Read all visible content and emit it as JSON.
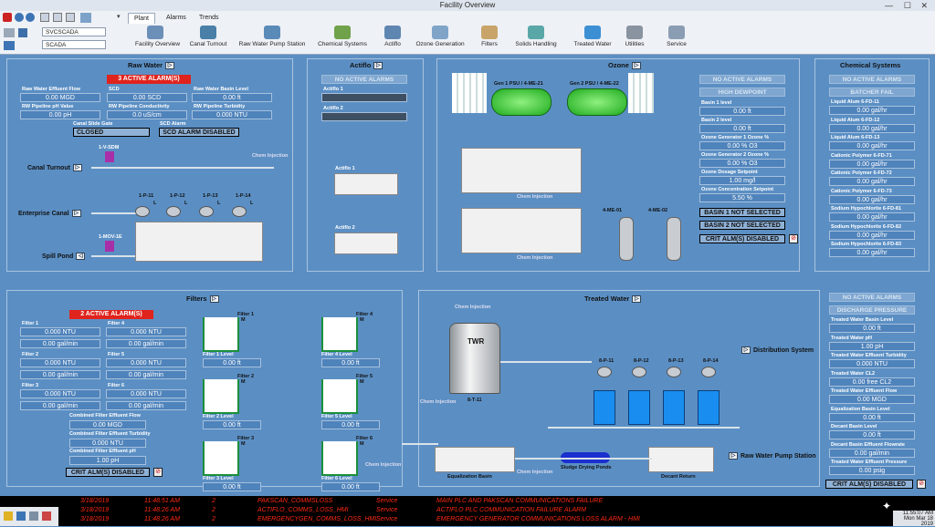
{
  "window": {
    "title": "Facility Overview",
    "minimize": "—",
    "maximize": "☐",
    "close": "✕"
  },
  "toolbar": {
    "tabs": [
      "Plant",
      "Alarms",
      "Trends"
    ],
    "server1": "SVCSCADA",
    "server2": "SCADA",
    "nav": [
      {
        "label": "Facility Overview",
        "icon": "home-icon",
        "color": "#6c8fb8"
      },
      {
        "label": "Canal Turnout",
        "icon": "canal-icon",
        "color": "#4a7fa8"
      },
      {
        "label": "Raw Water Pump Station",
        "icon": "pump-station-icon",
        "color": "#5a8ab8"
      },
      {
        "label": "Chemical Systems",
        "icon": "chemical-icon",
        "color": "#6fa24a"
      },
      {
        "label": "Actiflo",
        "icon": "actiflo-icon",
        "color": "#5f86b0"
      },
      {
        "label": "Ozone Generation",
        "icon": "ozone-icon",
        "color": "#7fa4c8"
      },
      {
        "label": "Filters",
        "icon": "filters-icon",
        "color": "#c9a46a"
      },
      {
        "label": "Solids Handling",
        "icon": "solids-icon",
        "color": "#5aa7a8"
      },
      {
        "label": "Treated Water",
        "icon": "water-drop-icon",
        "color": "#3c8fd2"
      },
      {
        "label": "Utilities",
        "icon": "wrench-icon",
        "color": "#8a93a0"
      },
      {
        "label": "Service",
        "icon": "service-icon",
        "color": "#8b9db3"
      }
    ]
  },
  "raw_water": {
    "title": "Raw Water",
    "alarm": "3 ACTIVE ALARM(S)",
    "fields": [
      {
        "label": "Raw Water Effluent Flow",
        "value": "0.00 MGD"
      },
      {
        "label": "SCD",
        "value": "0.00 SCD"
      },
      {
        "label": "Raw Water Basin Level",
        "value": "0.00 ft"
      },
      {
        "label": "RW Pipeline pH Value",
        "value": "0.00 pH"
      },
      {
        "label": "RW Pipeline Conductivity",
        "value": "0.0 uS/cm"
      },
      {
        "label": "RW Pipeline Turbidity",
        "value": "0.000 NTU"
      }
    ],
    "gate_label": "Canal Slide Gate",
    "gate_value": "CLOSED",
    "scd_alarm_label": "SCD Alarm",
    "scd_alarm_value": "SCD ALARM DISABLED",
    "canal_turnout": "Canal Turnout",
    "enterprise_canal": "Enterprise Canal",
    "spill_pond": "Spill Pond",
    "chem_injection": "Chem Injection",
    "pumps": [
      "1-P-11",
      "1-P-12",
      "1-P-13",
      "1-P-14"
    ],
    "valve1": "1-V-SDM",
    "valve2": "1-MOV-1E",
    "pump_l": "L"
  },
  "actiflo": {
    "title": "Actiflo",
    "no_alarms": "NO ACTIVE ALARMS",
    "f1_label": "Actiflo 1",
    "f2_label": "Actiflo 2",
    "unit1": "Actiflo 1",
    "unit2": "Actiflo 2"
  },
  "ozone": {
    "title": "Ozone",
    "gen1": "Gen 1 PSU / 4-ME-21",
    "gen2": "Gen 2 PSU / 4-ME-22",
    "chem1": "Chem Injection",
    "chem2": "Chem Injection",
    "tank1": "4-ME-01",
    "tank2": "4-ME-02",
    "no_alarms": "NO ACTIVE ALARMS",
    "dewpoint": "HIGH DEWPOINT",
    "fields": [
      {
        "label": "Basin 1 level",
        "value": "0.00 ft"
      },
      {
        "label": "Basin 2 level",
        "value": "0.00 ft"
      },
      {
        "label": "Ozone Generator 1 Ozone %",
        "value": "0.00 % O3"
      },
      {
        "label": "Ozone Generator 2 Ozone %",
        "value": "0.00 % O3"
      },
      {
        "label": "Ozone Dosage Setpoint",
        "value": "1.00 mg/l"
      },
      {
        "label": "Ozone Concentration Setpoint",
        "value": "5.50 %"
      }
    ],
    "basin1": "BASIN 1 NOT SELECTED",
    "basin2": "BASIN 2 NOT SELECTED",
    "crit": "CRIT ALM(S) DISABLED"
  },
  "chemical": {
    "title": "Chemical Systems",
    "no_alarms": "NO ACTIVE ALARMS",
    "batcher": "BATCHER FAIL",
    "fields": [
      {
        "label": "Liquid Alum 6-FD-11",
        "value": "0.00 gal/hr"
      },
      {
        "label": "Liquid Alum 6-FD-12",
        "value": "0.00 gal/hr"
      },
      {
        "label": "Liquid Alum 6-FD-13",
        "value": "0.00 gal/hr"
      },
      {
        "label": "Cationic Polymer 6-FD-71",
        "value": "0.00 gal/hr"
      },
      {
        "label": "Cationic Polymer 6-FD-72",
        "value": "0.00 gal/hr"
      },
      {
        "label": "Cationic Polymer 6-FD-73",
        "value": "0.00 gal/hr"
      },
      {
        "label": "Sodium Hypochlorite 6-FD-81",
        "value": "0.00 gal/hr"
      },
      {
        "label": "Sodium Hypochlorite 6-FD-82",
        "value": "0.00 gal/hr"
      },
      {
        "label": "Sodium Hypochlorite 6-FD-83",
        "value": "0.00 gal/hr"
      }
    ]
  },
  "filters": {
    "title": "Filters",
    "alarm": "2 ACTIVE ALARM(S)",
    "fields": [
      {
        "label": "Filter 1",
        "v1": "0.000 NTU",
        "v2": "0.00 gal/min"
      },
      {
        "label": "Filter 4",
        "v1": "0.000 NTU",
        "v2": "0.00 gal/min"
      },
      {
        "label": "Filter 2",
        "v1": "0.000 NTU",
        "v2": "0.00 gal/min"
      },
      {
        "label": "Filter 5",
        "v1": "0.000 NTU",
        "v2": "0.00 gal/min"
      },
      {
        "label": "Filter 3",
        "v1": "0.000 NTU",
        "v2": "0.00 gal/min"
      },
      {
        "label": "Filter 6",
        "v1": "0.000 NTU",
        "v2": "0.00 gal/min"
      }
    ],
    "comb_flow_label": "Combined Filter Effluent Flow",
    "comb_flow": "0.00 MGD",
    "comb_turb_label": "Combined Filter Effluent Turbidity",
    "comb_turb": "0.000 NTU",
    "comb_ph_label": "Combined Filter Effluent pH",
    "comb_ph": "1.00 pH",
    "crit": "CRIT ALM(S) DISABLED",
    "units": [
      {
        "name": "Filter 1",
        "lvl_label": "Filter 1 Level",
        "lvl": "0.00 ft"
      },
      {
        "name": "Filter 4",
        "lvl_label": "Filter 4 Level",
        "lvl": "0.00 ft"
      },
      {
        "name": "Filter 2",
        "lvl_label": "Filter 2 Level",
        "lvl": "0.00 ft"
      },
      {
        "name": "Filter 5",
        "lvl_label": "Filter 5 Level",
        "lvl": "0.00 ft"
      },
      {
        "name": "Filter 3",
        "lvl_label": "Filter 3 Level",
        "lvl": "0.00 ft"
      },
      {
        "name": "Filter 6",
        "lvl_label": "Filter 6 Level",
        "lvl": "0.00 ft"
      }
    ],
    "m": "M"
  },
  "treated": {
    "title": "Treated Water",
    "twr": "TWR",
    "tank_id": "8-T-11",
    "chem_top": "Chem Injection",
    "chem_left": "Chem Injection",
    "chem_bottom": "Chem Injection",
    "chem_filter": "Chem Injection",
    "pumps": [
      "8-P-11",
      "8-P-12",
      "8-P-13",
      "8-P-14"
    ],
    "distribution": "Distribution System",
    "rw_pump_station": "Raw Water Pump Station",
    "eq_basin": "Equalization Basin",
    "sludge": "Sludge Drying Ponds",
    "decant": "Decant Return",
    "no_alarms": "NO ACTIVE ALARMS",
    "discharge": "DISCHARGE PRESSURE",
    "fields": [
      {
        "label": "Treated Water Basin Level",
        "value": "0.00 ft"
      },
      {
        "label": "Treated Water pH",
        "value": "1.00 pH"
      },
      {
        "label": "Treated Water Effluent Turbidity",
        "value": "0.000 NTU"
      },
      {
        "label": "Treated Water CL2",
        "value": "0.00 free CL2"
      },
      {
        "label": "Treated Water Effluent Flow",
        "value": "0.00 MGD"
      },
      {
        "label": "Equalization Basin Level",
        "value": "0.00 ft"
      },
      {
        "label": "Decant Basin Level",
        "value": "0.00 ft"
      },
      {
        "label": "Decant Basin Effluent Flowrate",
        "value": "0.00 gal/min"
      },
      {
        "label": "Treated Water Effluent Pressure",
        "value": "0.00 psig"
      }
    ],
    "crit": "CRIT ALM(S) DISABLED"
  },
  "alarms": [
    {
      "date": "3/18/2019",
      "time": "11:48:51 AM",
      "pri": "2",
      "tag": "PAKSCAN_COMMSLOSS",
      "area": "Service",
      "desc": "MAIN PLC AND PAKSCAN COMMUNICATIONS FAILURE"
    },
    {
      "date": "3/18/2019",
      "time": "11:48:26 AM",
      "pri": "2",
      "tag": "ACTIFLO_COMMS_LOSS_HMI",
      "area": "Service",
      "desc": "ACTIFLO PLC COMMUNICATION FAILURE ALARM"
    },
    {
      "date": "3/18/2019",
      "time": "11:48:26 AM",
      "pri": "2",
      "tag": "EMERGENCYGEN_COMMS_LOSS_HMI",
      "area": "Service",
      "desc": "EMERGENCY GENERATOR COMMUNICATIONS LOSS ALARM - HMI"
    }
  ],
  "clock": {
    "time": "11:55:07 AM",
    "date": "Mon Mar 18 2019"
  }
}
